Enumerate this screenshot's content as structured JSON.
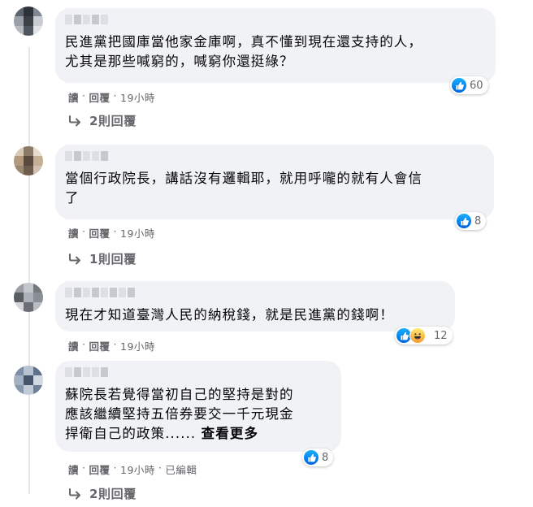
{
  "comments": [
    {
      "text": "民進黨把國庫當他家金庫啊，真不懂到現在還支持的人，\n尤其是那些喊窮的，喊窮你還挺綠？",
      "reaction_count": "60",
      "reply_label": "讀",
      "time": "19小時",
      "comment_reply": "回覆",
      "edited": "",
      "replies": "2則回覆"
    },
    {
      "text": "當個行政院長，講話沒有邏輯耶，就用呼嚨的就有人會信\n了",
      "reaction_count": "8",
      "reply_label": "讀",
      "time": "19小時",
      "comment_reply": "回覆",
      "edited": "",
      "replies": "1則回覆"
    },
    {
      "text": "現在才知道臺灣人民的納稅錢，就是民進黨的錢啊！",
      "reaction_count": "12",
      "reply_label": "讀",
      "time": "19小時",
      "comment_reply": "回覆",
      "edited": "",
      "replies": ""
    },
    {
      "text": "蘇院長若覺得當初自己的堅持是對的\n應該繼續堅持五倍券要交一千元現金\n捍衛自己的政策......",
      "see_more": "查看更多",
      "reaction_count": "8",
      "reply_label": "讀",
      "time": "19小時",
      "comment_reply": "回覆",
      "edited": "已編輯",
      "replies": "2則回覆"
    }
  ],
  "icons": {
    "like": "like-thumb-icon",
    "haha": "haha-face-icon",
    "reply": "reply-arrow-icon"
  },
  "colors": {
    "like_blue": "#1877f2",
    "muted": "#65676b",
    "bubble": "#f0f2f5"
  }
}
